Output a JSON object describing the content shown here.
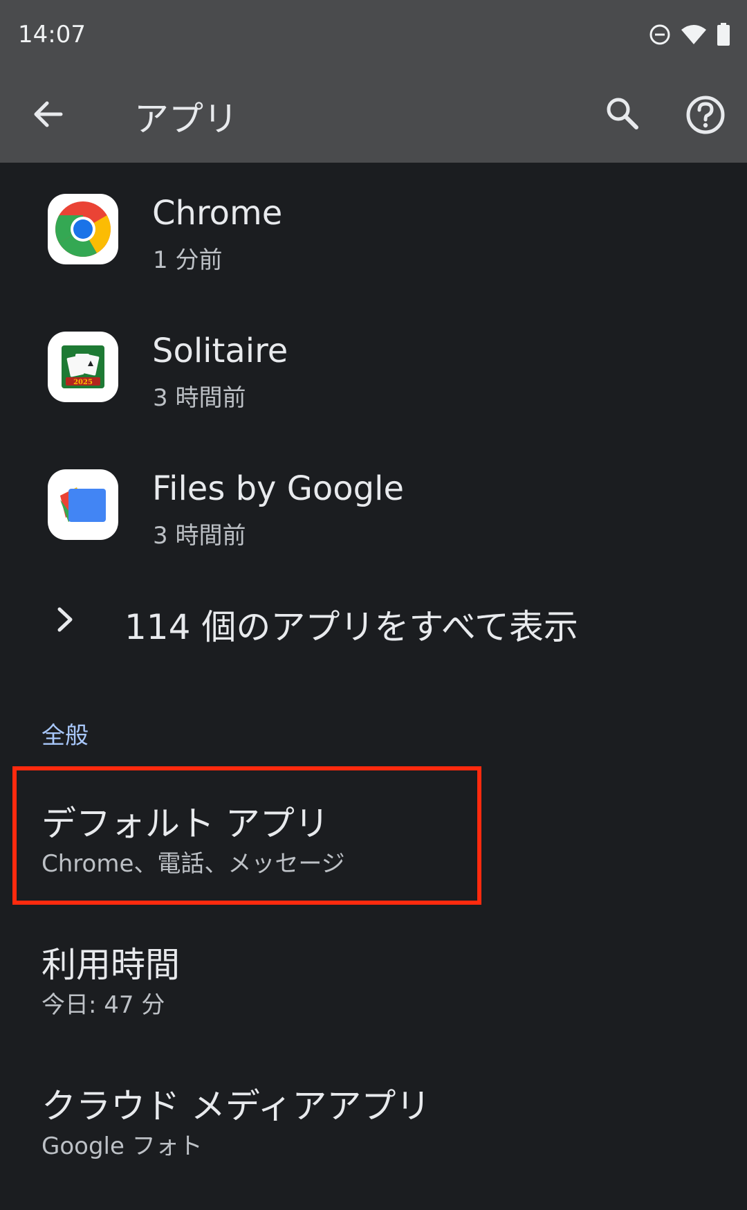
{
  "status_bar": {
    "time": "14:07",
    "icons": [
      "do-not-disturb-icon",
      "wifi-icon",
      "battery-icon"
    ]
  },
  "app_bar": {
    "title": "アプリ",
    "icons": [
      "back-arrow-icon",
      "search-icon",
      "help-icon"
    ]
  },
  "recent_apps": [
    {
      "name": "Chrome",
      "time": "1 分前",
      "icon": "chrome-icon"
    },
    {
      "name": "Solitaire",
      "time": "3 時間前",
      "icon": "solitaire-icon"
    },
    {
      "name": "Files by Google",
      "time": "3 時間前",
      "icon": "files-icon"
    }
  ],
  "see_all": {
    "label": "114 個のアプリをすべて表示",
    "icon": "chevron-right-icon"
  },
  "general": {
    "header": "全般",
    "items": [
      {
        "title": "デフォルト アプリ",
        "subtitle": "Chrome、電話、メッセージ"
      },
      {
        "title": "利用時間",
        "subtitle": "今日: 47 分"
      },
      {
        "title": "クラウド メディアアプリ",
        "subtitle": "Google フォト"
      }
    ]
  },
  "colors": {
    "background": "#1b1d20",
    "header_background": "#4a4b4d",
    "section_accent": "#a8c7fa",
    "highlight": "#ff2a0e"
  },
  "solitaire_badge": "2025"
}
